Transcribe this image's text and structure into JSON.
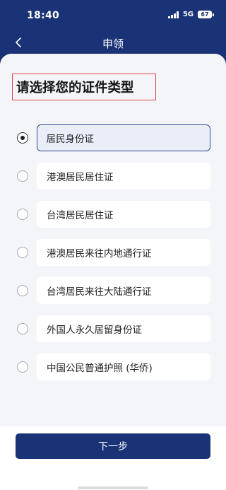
{
  "status_bar": {
    "time": "18:40",
    "network": "5G",
    "battery": "67"
  },
  "nav": {
    "title": "申领",
    "back_icon": "chevron-left-icon"
  },
  "heading": "请选择您的证件类型",
  "options": [
    {
      "label": "居民身份证",
      "selected": true
    },
    {
      "label": "港澳居民居住证",
      "selected": false
    },
    {
      "label": "台湾居民居住证",
      "selected": false
    },
    {
      "label": "港澳居民来往内地通行证",
      "selected": false
    },
    {
      "label": "台湾居民来往大陆通行证",
      "selected": false
    },
    {
      "label": "外国人永久居留身份证",
      "selected": false
    },
    {
      "label": "中国公民普通护照 (华侨)",
      "selected": false
    }
  ],
  "footer": {
    "next_label": "下一步"
  },
  "colors": {
    "brand": "#1a3276",
    "heading_box": "#e0404a",
    "selected_border": "#2c4a8c",
    "selected_fill": "#e9eef9",
    "content_bg": "#f4f5f8"
  }
}
